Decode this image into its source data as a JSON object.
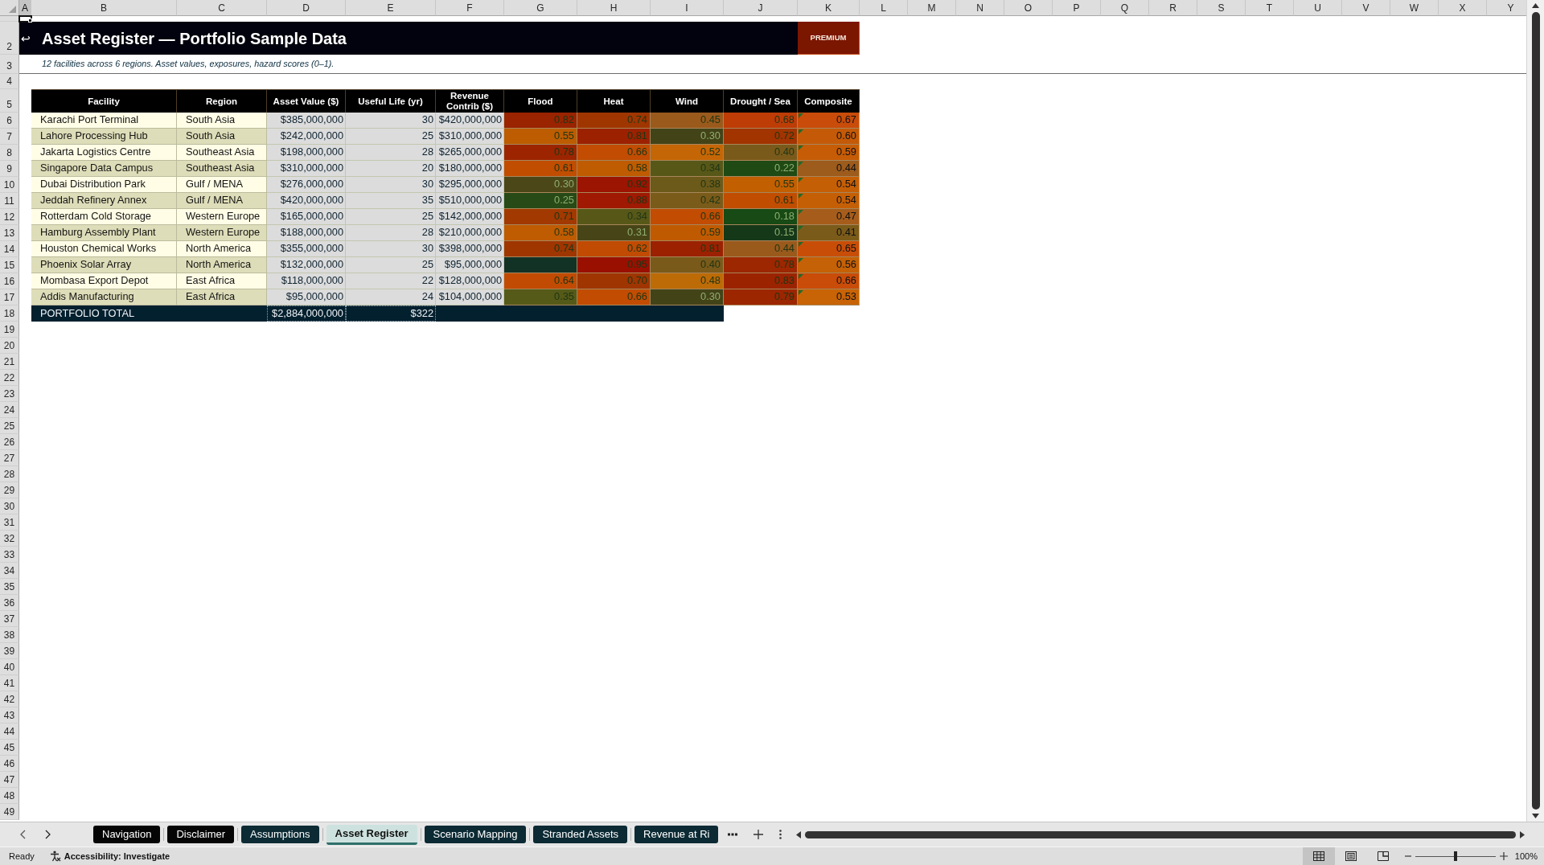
{
  "sheet": {
    "columns": [
      {
        "label": "A",
        "selected": true
      },
      {
        "label": "B",
        "selected": false
      },
      {
        "label": "C",
        "selected": false
      },
      {
        "label": "D",
        "selected": false
      },
      {
        "label": "E",
        "selected": false
      },
      {
        "label": "F",
        "selected": false
      },
      {
        "label": "G",
        "selected": false
      },
      {
        "label": "H",
        "selected": false
      },
      {
        "label": "I",
        "selected": false
      },
      {
        "label": "J",
        "selected": false
      },
      {
        "label": "K",
        "selected": false
      },
      {
        "label": "L",
        "selected": false
      },
      {
        "label": "M",
        "selected": false
      },
      {
        "label": "N",
        "selected": false
      },
      {
        "label": "O",
        "selected": false
      },
      {
        "label": "P",
        "selected": false
      },
      {
        "label": "Q",
        "selected": false
      },
      {
        "label": "R",
        "selected": false
      },
      {
        "label": "S",
        "selected": false
      },
      {
        "label": "T",
        "selected": false
      },
      {
        "label": "U",
        "selected": false
      },
      {
        "label": "V",
        "selected": false
      },
      {
        "label": "W",
        "selected": false
      },
      {
        "label": "X",
        "selected": false
      },
      {
        "label": "Y",
        "selected": false
      }
    ],
    "row_numbers": [
      "2",
      "3",
      "4",
      "5",
      "6",
      "7",
      "8",
      "9",
      "10",
      "11",
      "12",
      "13",
      "14",
      "15",
      "16",
      "17",
      "18",
      "19",
      "20",
      "21",
      "22",
      "23",
      "24",
      "25",
      "26",
      "27",
      "28",
      "29",
      "30",
      "31",
      "32",
      "33",
      "34",
      "35",
      "36",
      "37",
      "38",
      "39",
      "40",
      "41",
      "42",
      "43",
      "44",
      "45",
      "46",
      "47",
      "48",
      "49"
    ]
  },
  "banner": {
    "back_arrow": "↩",
    "title": "Asset Register — Portfolio Sample Data",
    "badge": "PREMIUM"
  },
  "subtitle": "12 facilities across 6 regions. Asset values, exposures, hazard scores (0–1).",
  "table": {
    "columns": [
      "Facility",
      "Region",
      "Asset Value ($)",
      "Useful Life (yr)",
      "Revenue Contrib ($)",
      "Flood",
      "Heat",
      "Wind",
      "Drought / Sea",
      "Composite"
    ],
    "rows": [
      {
        "facility": "Karachi Port Terminal",
        "region": "South Asia",
        "asset_value": "$385,000,000",
        "useful_life": "30",
        "revenue_contrib": "$420,000,000",
        "hazards": [
          {
            "value": "0.82",
            "color": "#9a2300"
          },
          {
            "value": "0.74",
            "color": "#9f3600"
          },
          {
            "value": "0.45",
            "color": "#9a5a1c"
          },
          {
            "value": "0.68",
            "color": "#be3c06"
          }
        ],
        "composite": {
          "value": "0.67",
          "color": "#c94c0a",
          "flagged": true
        }
      },
      {
        "facility": "Lahore Processing Hub",
        "region": "South Asia",
        "asset_value": "$242,000,000",
        "useful_life": "25",
        "revenue_contrib": "$310,000,000",
        "hazards": [
          {
            "value": "0.55",
            "color": "#bd5c00"
          },
          {
            "value": "0.81",
            "color": "#9c2100"
          },
          {
            "value": "0.30",
            "color": "#434318"
          },
          {
            "value": "0.72",
            "color": "#a23400"
          }
        ],
        "composite": {
          "value": "0.60",
          "color": "#c45a08",
          "flagged": true
        }
      },
      {
        "facility": "Jakarta Logistics Centre",
        "region": "Southeast Asia",
        "asset_value": "$198,000,000",
        "useful_life": "28",
        "revenue_contrib": "$265,000,000",
        "hazards": [
          {
            "value": "0.78",
            "color": "#9c2500"
          },
          {
            "value": "0.66",
            "color": "#c14c02"
          },
          {
            "value": "0.52",
            "color": "#c56606"
          },
          {
            "value": "0.40",
            "color": "#7a5a1a"
          }
        ],
        "composite": {
          "value": "0.59",
          "color": "#c65c06",
          "flagged": true
        }
      },
      {
        "facility": "Singapore Data Campus",
        "region": "Southeast Asia",
        "asset_value": "$310,000,000",
        "useful_life": "20",
        "revenue_contrib": "$180,000,000",
        "hazards": [
          {
            "value": "0.61",
            "color": "#c14d00"
          },
          {
            "value": "0.58",
            "color": "#bf5b00"
          },
          {
            "value": "0.34",
            "color": "#575818"
          },
          {
            "value": "0.22",
            "color": "#1f4a14"
          }
        ],
        "composite": {
          "value": "0.44",
          "color": "#9d5b1c",
          "flagged": true
        }
      },
      {
        "facility": "Dubai Distribution Park",
        "region": "Gulf / MENA",
        "asset_value": "$276,000,000",
        "useful_life": "30",
        "revenue_contrib": "$295,000,000",
        "hazards": [
          {
            "value": "0.30",
            "color": "#4b4718"
          },
          {
            "value": "0.92",
            "color": "#9c1402"
          },
          {
            "value": "0.38",
            "color": "#6b5a1a"
          },
          {
            "value": "0.55",
            "color": "#c25f00"
          }
        ],
        "composite": {
          "value": "0.54",
          "color": "#c55f06",
          "flagged": true
        }
      },
      {
        "facility": "Jeddah Refinery Annex",
        "region": "Gulf / MENA",
        "asset_value": "$420,000,000",
        "useful_life": "35",
        "revenue_contrib": "$510,000,000",
        "hazards": [
          {
            "value": "0.25",
            "color": "#274a16"
          },
          {
            "value": "0.88",
            "color": "#a01902"
          },
          {
            "value": "0.42",
            "color": "#7a5b1a"
          },
          {
            "value": "0.61",
            "color": "#c14d00"
          }
        ],
        "composite": {
          "value": "0.54",
          "color": "#c55f06",
          "flagged": true
        }
      },
      {
        "facility": "Rotterdam Cold Storage",
        "region": "Western Europe",
        "asset_value": "$165,000,000",
        "useful_life": "25",
        "revenue_contrib": "$142,000,000",
        "hazards": [
          {
            "value": "0.71",
            "color": "#a13900"
          },
          {
            "value": "0.34",
            "color": "#575818"
          },
          {
            "value": "0.66",
            "color": "#c14c02"
          },
          {
            "value": "0.18",
            "color": "#174a14"
          }
        ],
        "composite": {
          "value": "0.47",
          "color": "#a65d1c",
          "flagged": true
        }
      },
      {
        "facility": "Hamburg Assembly Plant",
        "region": "Western Europe",
        "asset_value": "$188,000,000",
        "useful_life": "28",
        "revenue_contrib": "$210,000,000",
        "hazards": [
          {
            "value": "0.58",
            "color": "#bf5b00"
          },
          {
            "value": "0.31",
            "color": "#474518"
          },
          {
            "value": "0.59",
            "color": "#c05a00"
          },
          {
            "value": "0.15",
            "color": "#153818"
          }
        ],
        "composite": {
          "value": "0.41",
          "color": "#7b5b1a",
          "flagged": true
        }
      },
      {
        "facility": "Houston Chemical Works",
        "region": "North America",
        "asset_value": "$355,000,000",
        "useful_life": "30",
        "revenue_contrib": "$398,000,000",
        "hazards": [
          {
            "value": "0.74",
            "color": "#9f3600"
          },
          {
            "value": "0.62",
            "color": "#c14b02"
          },
          {
            "value": "0.81",
            "color": "#9c2100"
          },
          {
            "value": "0.44",
            "color": "#9a5a1c"
          }
        ],
        "composite": {
          "value": "0.65",
          "color": "#c84e08",
          "flagged": true
        }
      },
      {
        "facility": "Phoenix Solar Array",
        "region": "North America",
        "asset_value": "$132,000,000",
        "useful_life": "25",
        "revenue_contrib": "$95,000,000",
        "hazards": [
          {
            "color": "#133226"
          },
          {
            "value": "0.95",
            "color": "#9a1000"
          },
          {
            "value": "0.40",
            "color": "#7a5a1a"
          },
          {
            "value": "0.78",
            "color": "#9c2700"
          }
        ],
        "composite": {
          "value": "0.56",
          "color": "#c56106",
          "flagged": true
        }
      },
      {
        "facility": "Mombasa Export Depot",
        "region": "East Africa",
        "asset_value": "$118,000,000",
        "useful_life": "22",
        "revenue_contrib": "$128,000,000",
        "hazards": [
          {
            "value": "0.64",
            "color": "#c14b02"
          },
          {
            "value": "0.70",
            "color": "#9f3500"
          },
          {
            "value": "0.48",
            "color": "#bd6b06"
          },
          {
            "value": "0.83",
            "color": "#9c2300"
          }
        ],
        "composite": {
          "value": "0.66",
          "color": "#c94c08",
          "flagged": true
        }
      },
      {
        "facility": "Addis Manufacturing",
        "region": "East Africa",
        "asset_value": "$95,000,000",
        "useful_life": "24",
        "revenue_contrib": "$104,000,000",
        "hazards": [
          {
            "value": "0.35",
            "color": "#555a18"
          },
          {
            "value": "0.66",
            "color": "#c14c02"
          },
          {
            "value": "0.30",
            "color": "#434318"
          },
          {
            "value": "0.79",
            "color": "#9c2600"
          }
        ],
        "composite": {
          "value": "0.53",
          "color": "#c86306",
          "flagged": true
        }
      }
    ],
    "total": {
      "label": "PORTFOLIO TOTAL",
      "asset_value": "$2,884,000,000",
      "useful_life": "$322"
    }
  },
  "sheet_tabs": [
    {
      "label": "Navigation",
      "selected": false,
      "color": "#050505"
    },
    {
      "label": "Disclaimer",
      "selected": false,
      "color": "#050505"
    },
    {
      "label": "Assumptions",
      "selected": false,
      "color": "#0c2b34"
    },
    {
      "label": "Asset Register",
      "selected": true,
      "color": "#2f6f6a"
    },
    {
      "label": "Scenario Mapping",
      "selected": false,
      "color": "#0b2a34"
    },
    {
      "label": "Stranded Assets",
      "selected": false,
      "color": "#0b2a34"
    },
    {
      "label": "Revenue at Ri",
      "selected": false,
      "color": "#0b2a34"
    }
  ],
  "status_bar": {
    "status": "Ready",
    "accessibility": "Accessibility: Investigate",
    "views": [
      {
        "kind": "normal",
        "selected": true
      },
      {
        "kind": "page_layout",
        "selected": false
      },
      {
        "kind": "page_break",
        "selected": false
      }
    ],
    "zoom_slider": {
      "level": 0.5
    },
    "zoom": "100%"
  }
}
